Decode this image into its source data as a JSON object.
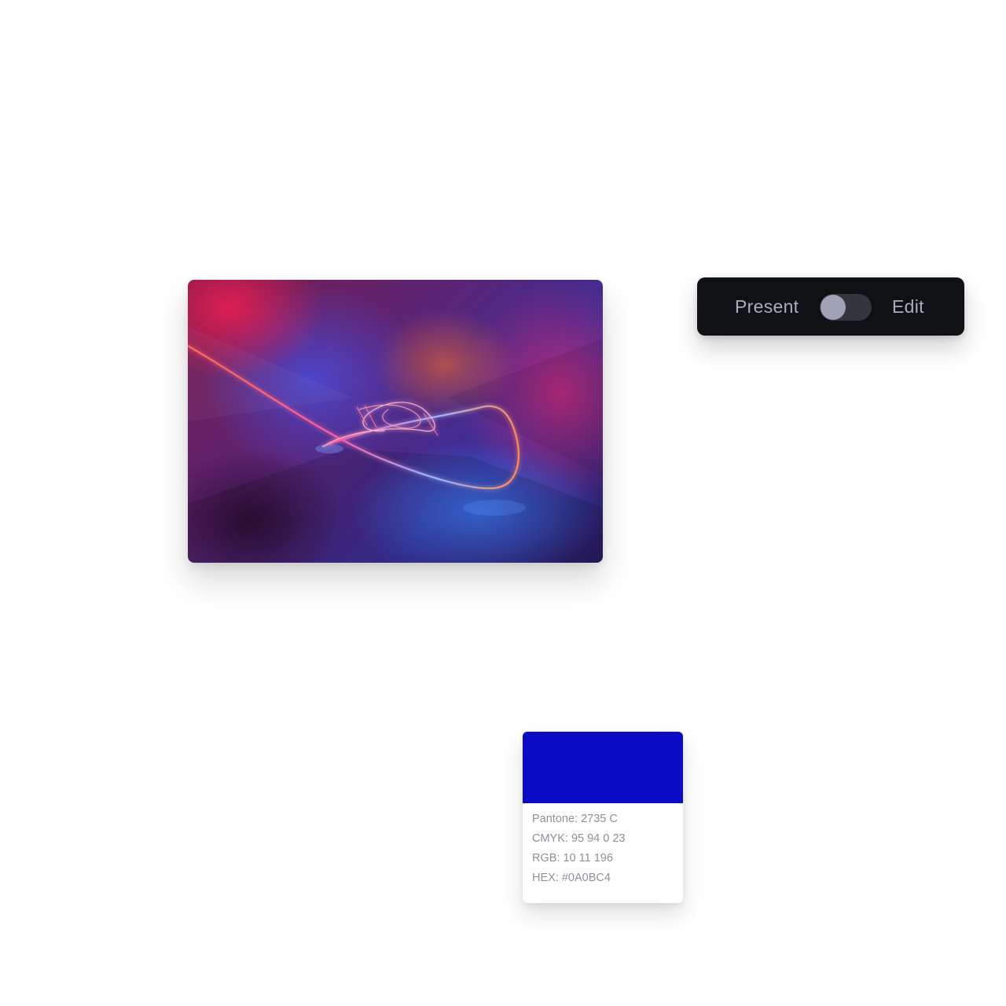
{
  "image": {
    "alt": ""
  },
  "mode_switch": {
    "left_label": "Present",
    "right_label": "Edit",
    "state": "present"
  },
  "swatch": {
    "color": "#0A0BC4",
    "pantone": "Pantone: 2735 C",
    "cmyk": "CMYK: 95 94 0 23",
    "rgb": "RGB: 10 11 196",
    "hex": "HEX: #0A0BC4"
  },
  "colors": {
    "toggle_bar_bg": "#101114",
    "toggle_label": "#a9adbd",
    "swatch_text": "#8d9099"
  }
}
